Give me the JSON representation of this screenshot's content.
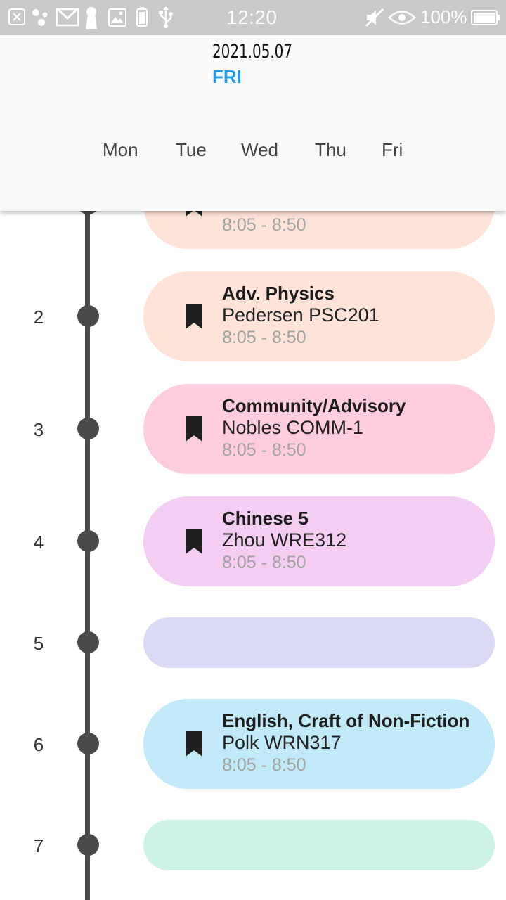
{
  "status_bar": {
    "time": "12:20",
    "battery": "100%",
    "icons": [
      "close-notification-icon",
      "dots-icon",
      "gmail-icon",
      "keyhole-icon",
      "image-icon",
      "battery-small-icon",
      "usb-icon",
      "mute-icon",
      "eye-icon",
      "battery-icon"
    ]
  },
  "header": {
    "date": "2021.05.07",
    "day": "FRI",
    "weekdays": [
      "Mon",
      "Tue",
      "Wed",
      "Thu",
      "Fri"
    ]
  },
  "periods": [
    {
      "number": "",
      "course": "",
      "teacher_room": "",
      "time": "8:05 - 8:50",
      "color": "#ffe3d9"
    },
    {
      "number": "2",
      "course": "Adv. Physics",
      "teacher_room": "Pedersen PSC201",
      "time": "8:05 - 8:50",
      "color": "#ffe3d9"
    },
    {
      "number": "3",
      "course": "Community/Advisory",
      "teacher_room": "Nobles COMM-1",
      "time": "8:05 - 8:50",
      "color": "#fecddc"
    },
    {
      "number": "4",
      "course": "Chinese 5",
      "teacher_room": "Zhou WRE312",
      "time": "8:05 - 8:50",
      "color": "#f4cdf3"
    },
    {
      "number": "5",
      "course": "",
      "teacher_room": "",
      "time": "",
      "color": "#d9d9f3"
    },
    {
      "number": "6",
      "course": "English, Craft of Non-Fiction",
      "teacher_room": "Polk WRN317",
      "time": "8:05 - 8:50",
      "color": "#c2e9f8"
    },
    {
      "number": "7",
      "course": "",
      "teacher_room": "",
      "time": "",
      "color": "#cdf3e9"
    }
  ],
  "colors": {
    "accent": "#1e9be9",
    "timeline": "#4a4a4a",
    "status_bar": "#c9c9c9"
  }
}
